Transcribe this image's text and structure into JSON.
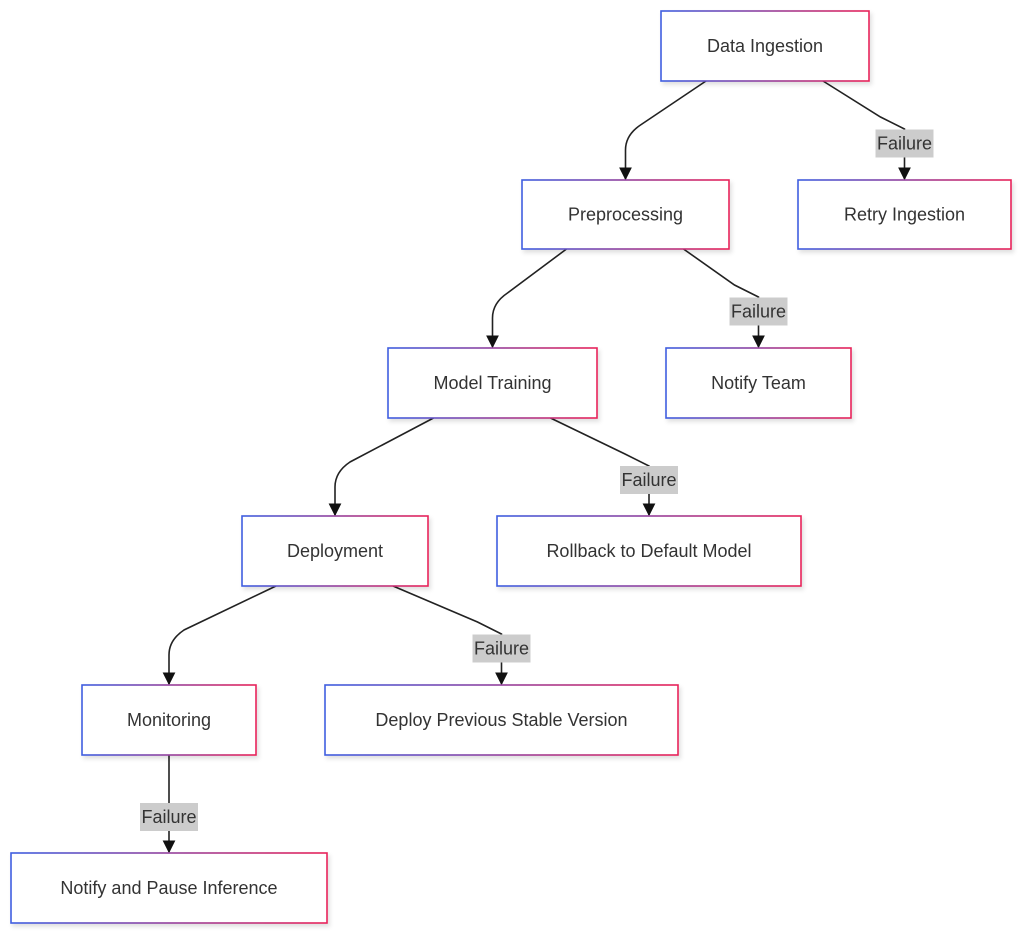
{
  "colors": {
    "border_start": "#3f5ee0",
    "border_end": "#e8245a",
    "edge": "#222222",
    "label_bg": "#cccccc",
    "text": "#333333"
  },
  "nodes": [
    {
      "id": "ingest",
      "label": "Data Ingestion"
    },
    {
      "id": "retry",
      "label": "Retry Ingestion"
    },
    {
      "id": "prep",
      "label": "Preprocessing"
    },
    {
      "id": "notify",
      "label": "Notify Team"
    },
    {
      "id": "train",
      "label": "Model Training"
    },
    {
      "id": "rollback",
      "label": "Rollback to Default Model"
    },
    {
      "id": "deploy",
      "label": "Deployment"
    },
    {
      "id": "prevver",
      "label": "Deploy Previous Stable Version"
    },
    {
      "id": "monitor",
      "label": "Monitoring"
    },
    {
      "id": "pause",
      "label": "Notify and Pause Inference"
    }
  ],
  "edges": [
    {
      "from": "ingest",
      "to": "prep",
      "label": ""
    },
    {
      "from": "ingest",
      "to": "retry",
      "label": "Failure"
    },
    {
      "from": "prep",
      "to": "train",
      "label": ""
    },
    {
      "from": "prep",
      "to": "notify",
      "label": "Failure"
    },
    {
      "from": "train",
      "to": "deploy",
      "label": ""
    },
    {
      "from": "train",
      "to": "rollback",
      "label": "Failure"
    },
    {
      "from": "deploy",
      "to": "monitor",
      "label": ""
    },
    {
      "from": "deploy",
      "to": "prevver",
      "label": "Failure"
    },
    {
      "from": "monitor",
      "to": "pause",
      "label": "Failure"
    }
  ]
}
